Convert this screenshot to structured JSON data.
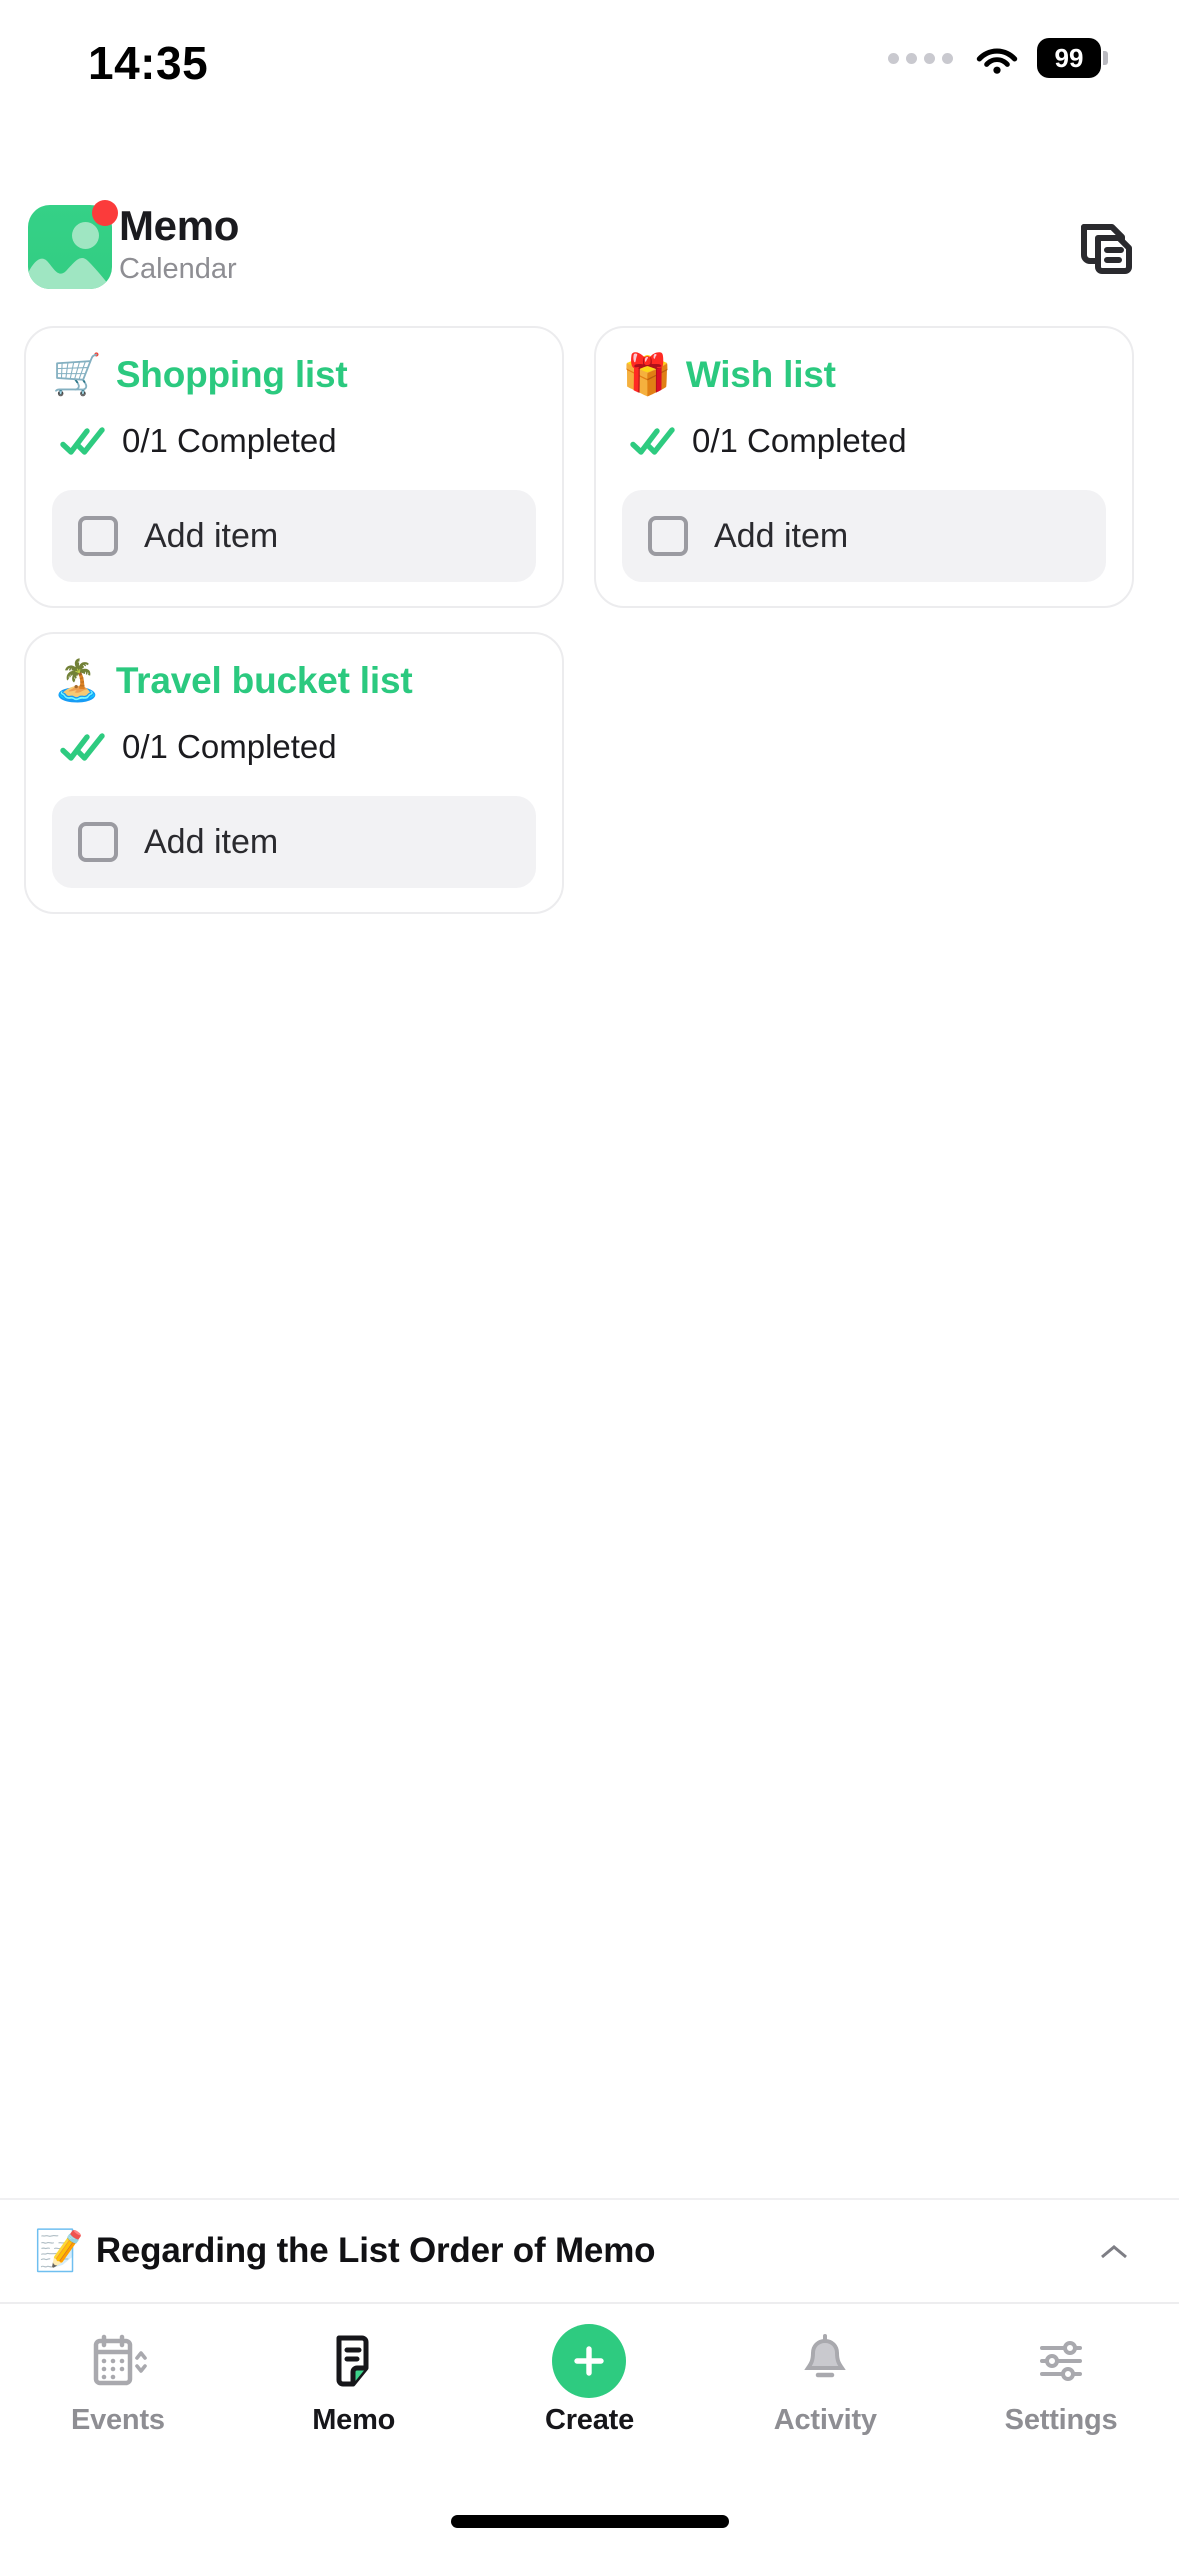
{
  "status_bar": {
    "time": "14:35",
    "signal_dots": 4,
    "wifi_icon": "wifi-icon",
    "battery_level": "99"
  },
  "header": {
    "app_icon": "photo-gallery-icon",
    "notification_badge": true,
    "title": "Memo",
    "subtitle": "Calendar",
    "action_icon": "stacked-notes-icon",
    "brand_green": "#2ecb80",
    "badge_red": "#fb3b3b"
  },
  "lists": [
    {
      "emoji": "🛒",
      "emoji_name": "shopping-cart-emoji",
      "title": "Shopping list",
      "completed_icon": "double-check-icon",
      "completed_text": "0/1 Completed",
      "add_item_label": "Add item",
      "checkbox_state": "unchecked"
    },
    {
      "emoji": "🎁",
      "emoji_name": "gift-emoji",
      "title": "Wish list",
      "completed_icon": "double-check-icon",
      "completed_text": "0/1 Completed",
      "add_item_label": "Add item",
      "checkbox_state": "unchecked"
    },
    {
      "emoji": "🏝️",
      "emoji_name": "island-palm-tree-emoji",
      "title": "Travel bucket list",
      "completed_icon": "double-check-icon",
      "completed_text": "0/1 Completed",
      "add_item_label": "Add item",
      "checkbox_state": "unchecked"
    }
  ],
  "banner": {
    "emoji": "📝",
    "emoji_name": "memo-pencil-emoji",
    "text": "Regarding the List Order of Memo",
    "collapse_icon": "chevron-up-icon"
  },
  "tabbar": {
    "items": [
      {
        "label": "Events",
        "icon": "calendar-sort-icon",
        "active": false
      },
      {
        "label": "Memo",
        "icon": "note-document-icon",
        "active": true
      },
      {
        "label": "Create",
        "icon": "plus-circle-icon",
        "active": false
      },
      {
        "label": "Activity",
        "icon": "bell-icon",
        "active": false
      },
      {
        "label": "Settings",
        "icon": "sliders-icon",
        "active": false
      }
    ],
    "active_color": "#16161a",
    "inactive_color": "#8e8e93",
    "create_color": "#2ecb80"
  }
}
